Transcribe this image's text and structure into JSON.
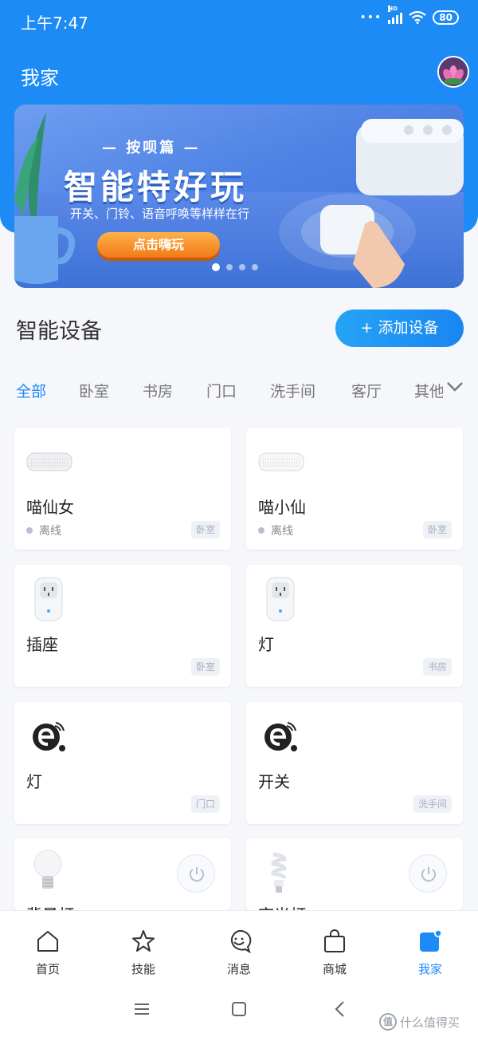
{
  "status_bar": {
    "time": "上午7:47",
    "network": "HD",
    "battery": "80"
  },
  "header": {
    "title": "我家"
  },
  "banner": {
    "subtitle": "— 按呗篇 —",
    "title": "智能特好玩",
    "description": "开关、门铃、语音呼唤等样样在行",
    "cta": "点击嗨玩",
    "slide_count": 4,
    "active_slide": 1
  },
  "devices_section": {
    "title": "智能设备",
    "add_button": "+ 添加设备"
  },
  "room_tabs": [
    {
      "label": "全部",
      "active": true
    },
    {
      "label": "卧室"
    },
    {
      "label": "书房"
    },
    {
      "label": "门口"
    },
    {
      "label": "洗手间"
    },
    {
      "label": "客厅"
    },
    {
      "label": "其他"
    }
  ],
  "devices": [
    {
      "name": "喵仙女",
      "status": "离线",
      "room": "卧室",
      "icon": "speaker-icon"
    },
    {
      "name": "喵小仙",
      "status": "离线",
      "room": "卧室",
      "icon": "speaker-icon"
    },
    {
      "name": "插座",
      "room": "卧室",
      "icon": "smart-plug-icon"
    },
    {
      "name": "灯",
      "room": "书房",
      "icon": "smart-plug-icon"
    },
    {
      "name": "灯",
      "room": "门口",
      "icon": "wifi-module-icon"
    },
    {
      "name": "开关",
      "room": "洗手间",
      "icon": "wifi-module-icon"
    },
    {
      "name": "背景灯",
      "icon": "light-bulb-icon",
      "has_power_button": true
    },
    {
      "name": "夜光灯",
      "icon": "spiral-bulb-icon",
      "has_power_button": true
    }
  ],
  "bottom_nav": [
    {
      "label": "首页",
      "icon": "home-icon"
    },
    {
      "label": "技能",
      "icon": "star-icon"
    },
    {
      "label": "消息",
      "icon": "message-icon"
    },
    {
      "label": "商城",
      "icon": "shop-bag-icon"
    },
    {
      "label": "我家",
      "icon": "my-home-icon",
      "active": true
    }
  ],
  "system_nav": [
    "menu",
    "home",
    "back"
  ],
  "watermark": "什么值得买",
  "colors": {
    "primary": "#1c8bf5",
    "background": "#f5f7fa"
  }
}
